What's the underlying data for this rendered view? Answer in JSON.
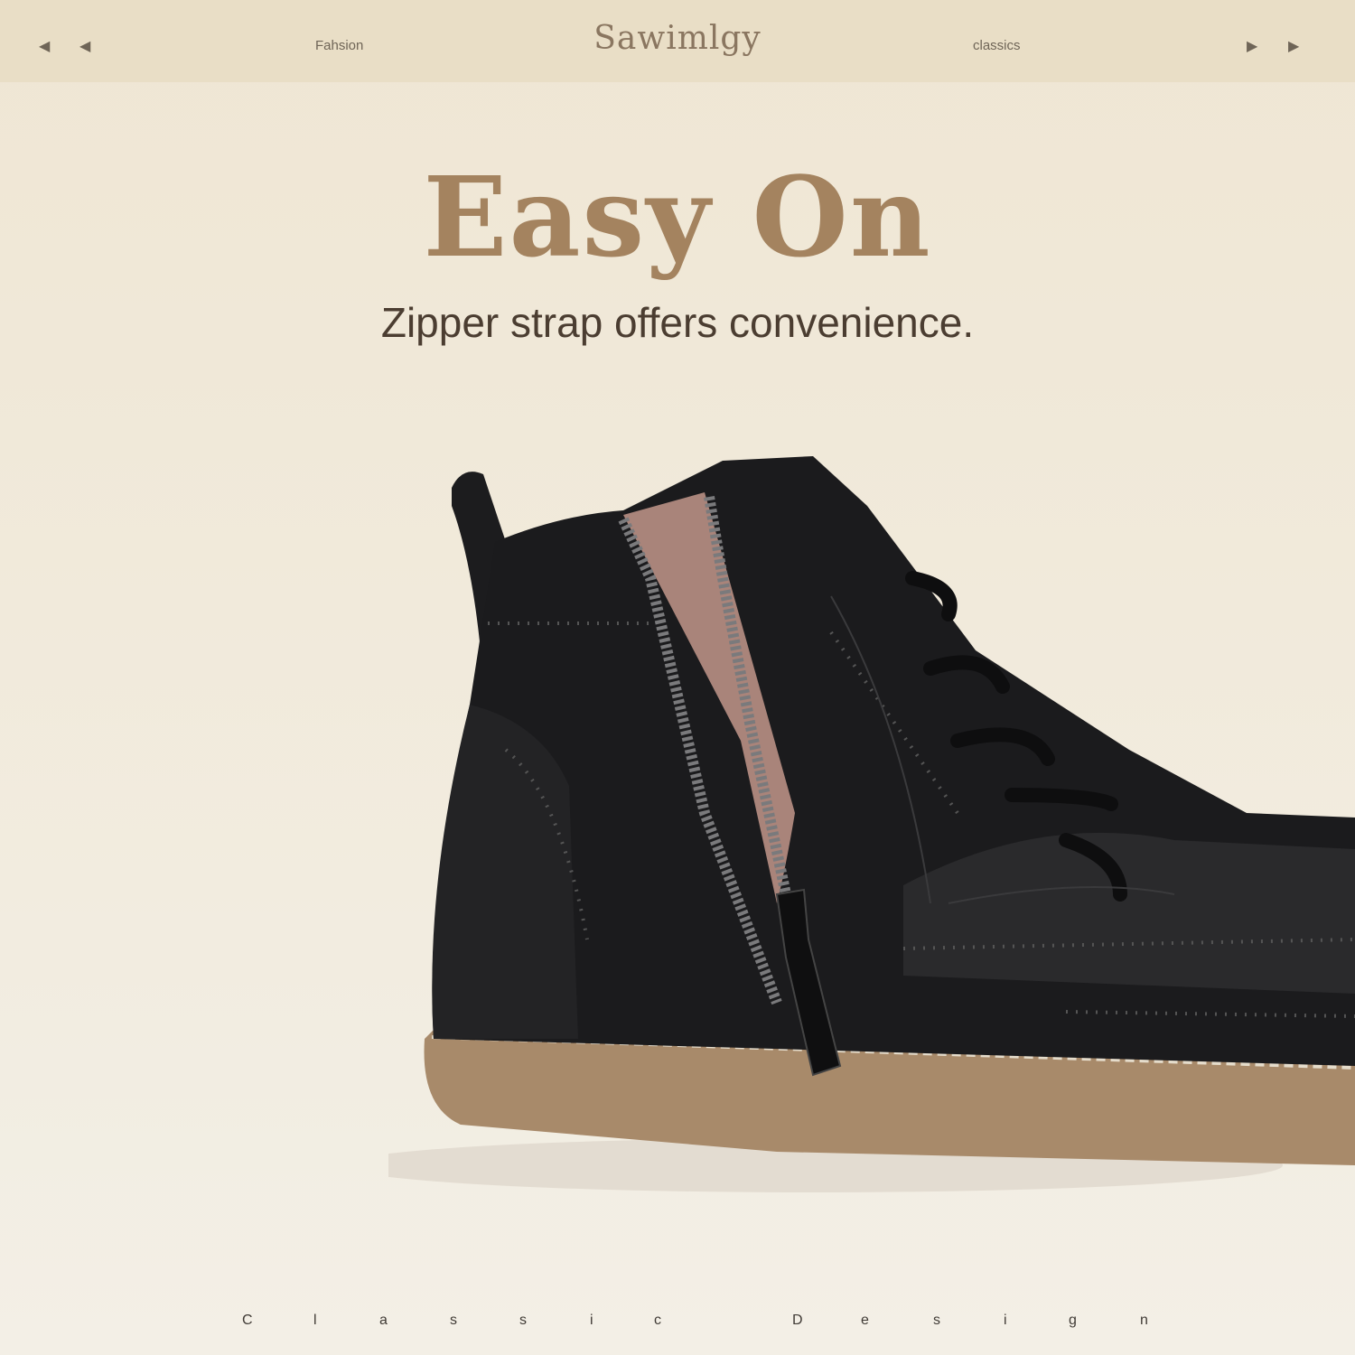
{
  "header": {
    "brand": "Sawimlgy",
    "left_link": "Fahsion",
    "right_link": "classics",
    "left_arrows": [
      "◀",
      "◀"
    ],
    "right_arrows": [
      "▶",
      "▶"
    ]
  },
  "hero": {
    "headline": "Easy On",
    "subheadline": "Zipper strap offers convenience."
  },
  "footer": {
    "caption_letters": [
      "C",
      "l",
      "a",
      "s",
      "s",
      "i",
      "c",
      "D",
      "e",
      "s",
      "i",
      "g",
      "n"
    ]
  },
  "colors": {
    "header_bg": "#e9dec6",
    "headline": "#a4835f",
    "subheadline": "#4b3d31",
    "boot_leather": "#1b1b1d",
    "sole": "#a88a6a"
  },
  "image": {
    "subject": "black-leather-zip-ankle-boot"
  }
}
